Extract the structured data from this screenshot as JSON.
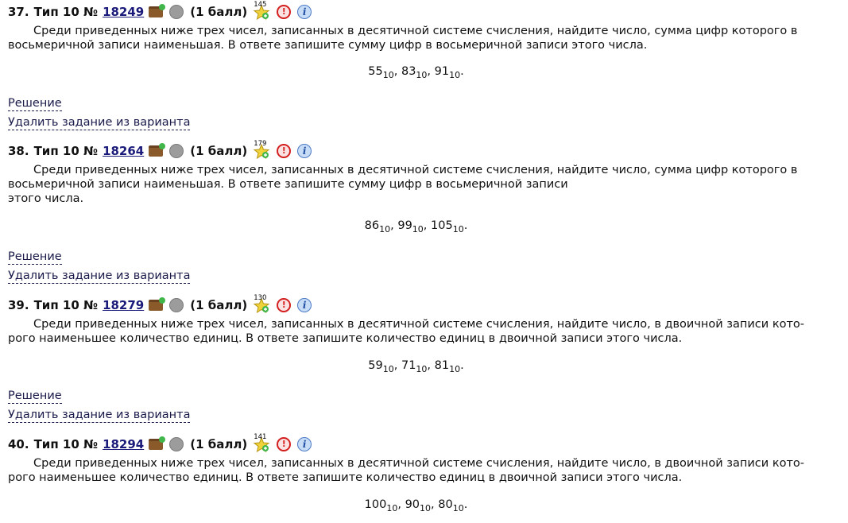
{
  "solution_label": "Решение",
  "remove_label": "Удалить задание из варианта",
  "tasks": [
    {
      "num": "37.",
      "type": "Тип 10 №",
      "id": "18249",
      "points": "(1 балл)",
      "count": "145",
      "lines": [
        "Среди приведенных ниже трех чисел, записанных в десятичной системе счисления, найдите число, сумма цифр которого в",
        "восьмеричной записи наименьшая. В ответе запишите сумму цифр в восьмеричной записи этого числа."
      ],
      "numbers": [
        {
          "v": "55",
          "b": "10",
          "s": ", "
        },
        {
          "v": "83",
          "b": "10",
          "s": ", "
        },
        {
          "v": "91",
          "b": "10",
          "s": "."
        }
      ]
    },
    {
      "num": "38.",
      "type": "Тип 10 №",
      "id": "18264",
      "points": "(1 балл)",
      "count": "179",
      "lines": [
        "Среди приведенных ниже трех чисел, записанных в десятичной системе счисления, найдите число, сумма цифр которого в",
        "восьмеричной записи наименьшая. В ответе запишите сумму цифр в восьмеричной записи",
        "этого числа."
      ],
      "numbers": [
        {
          "v": "86",
          "b": "10",
          "s": ", "
        },
        {
          "v": "99",
          "b": "10",
          "s": ", "
        },
        {
          "v": "105",
          "b": "10",
          "s": "."
        }
      ]
    },
    {
      "num": "39.",
      "type": "Тип 10 №",
      "id": "18279",
      "points": "(1 балл)",
      "count": "130",
      "lines": [
        "Среди приведенных ниже трех чисел, записанных в десятичной системе счисления, найдите число, в двоичной записи кото-",
        "рого наименьшее количество единиц. В ответе запишите количество единиц в двоичной записи этого числа."
      ],
      "numbers": [
        {
          "v": "59",
          "b": "10",
          "s": ", "
        },
        {
          "v": "71",
          "b": "10",
          "s": ", "
        },
        {
          "v": "81",
          "b": "10",
          "s": "."
        }
      ]
    },
    {
      "num": "40.",
      "type": "Тип 10 №",
      "id": "18294",
      "points": "(1 балл)",
      "count": "141",
      "lines": [
        "Среди приведенных ниже трех чисел, записанных в десятичной системе счисления, найдите число, в двоичной записи кото-",
        "рого наименьшее количество единиц. В ответе запишите количество единиц в двоичной записи этого числа."
      ],
      "numbers": [
        {
          "v": "100",
          "b": "10",
          "s": ", "
        },
        {
          "v": "90",
          "b": "10",
          "s": ", "
        },
        {
          "v": "80",
          "b": "10",
          "s": "."
        }
      ]
    }
  ]
}
